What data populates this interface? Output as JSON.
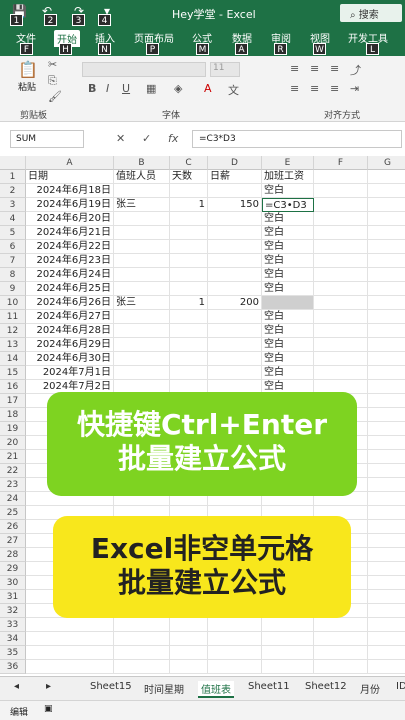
{
  "titlebar": {
    "title": "Hey学堂  -  Excel",
    "search_label": "搜索",
    "keytips": [
      "1",
      "2",
      "3",
      "4"
    ]
  },
  "ribbon_tabs": [
    {
      "label": "文件",
      "key": "F"
    },
    {
      "label": "开始",
      "key": "H",
      "active": true
    },
    {
      "label": "插入",
      "key": "N"
    },
    {
      "label": "页面布局",
      "key": "P"
    },
    {
      "label": "公式",
      "key": "M"
    },
    {
      "label": "数据",
      "key": "A"
    },
    {
      "label": "审阅",
      "key": "R"
    },
    {
      "label": "视图",
      "key": "W"
    },
    {
      "label": "开发工具",
      "key": "L"
    }
  ],
  "ribbon": {
    "paste_label": "粘贴",
    "clipboard_label": "剪贴板",
    "font_label": "字体",
    "align_label": "对齐方式",
    "font_size": "11"
  },
  "formula_bar": {
    "name_box": "SUM",
    "formula": "=C3*D3"
  },
  "columns": [
    "A",
    "B",
    "C",
    "D",
    "E",
    "F",
    "G"
  ],
  "rows": [
    {
      "n": "1",
      "a": "日期",
      "b": "值班人员",
      "c": "天数",
      "d": "日薪",
      "e": "加班工资"
    },
    {
      "n": "2",
      "a": "2024年6月18日",
      "b": "",
      "c": "",
      "d": "",
      "e": "空白"
    },
    {
      "n": "3",
      "a": "2024年6月19日",
      "b": "张三",
      "c": "1",
      "d": "150",
      "e": "=C3•D3"
    },
    {
      "n": "4",
      "a": "2024年6月20日",
      "b": "",
      "c": "",
      "d": "",
      "e": "空白"
    },
    {
      "n": "5",
      "a": "2024年6月21日",
      "b": "",
      "c": "",
      "d": "",
      "e": "空白"
    },
    {
      "n": "6",
      "a": "2024年6月22日",
      "b": "",
      "c": "",
      "d": "",
      "e": "空白"
    },
    {
      "n": "7",
      "a": "2024年6月23日",
      "b": "",
      "c": "",
      "d": "",
      "e": "空白"
    },
    {
      "n": "8",
      "a": "2024年6月24日",
      "b": "",
      "c": "",
      "d": "",
      "e": "空白"
    },
    {
      "n": "9",
      "a": "2024年6月25日",
      "b": "",
      "c": "",
      "d": "",
      "e": "空白"
    },
    {
      "n": "10",
      "a": "2024年6月26日",
      "b": "张三",
      "c": "1",
      "d": "200",
      "e": ""
    },
    {
      "n": "11",
      "a": "2024年6月27日",
      "b": "",
      "c": "",
      "d": "",
      "e": "空白"
    },
    {
      "n": "12",
      "a": "2024年6月28日",
      "b": "",
      "c": "",
      "d": "",
      "e": "空白"
    },
    {
      "n": "13",
      "a": "2024年6月29日",
      "b": "",
      "c": "",
      "d": "",
      "e": "空白"
    },
    {
      "n": "14",
      "a": "2024年6月30日",
      "b": "",
      "c": "",
      "d": "",
      "e": "空白"
    },
    {
      "n": "15",
      "a": "2024年7月1日",
      "b": "",
      "c": "",
      "d": "",
      "e": "空白"
    },
    {
      "n": "16",
      "a": "2024年7月2日",
      "b": "",
      "c": "",
      "d": "",
      "e": "空白"
    },
    {
      "n": "17",
      "a": "20",
      "b": "",
      "c": "",
      "d": "",
      "e": "空白"
    },
    {
      "n": "18"
    },
    {
      "n": "19"
    },
    {
      "n": "20"
    },
    {
      "n": "21"
    },
    {
      "n": "22"
    },
    {
      "n": "23"
    },
    {
      "n": "24"
    },
    {
      "n": "25"
    },
    {
      "n": "26"
    },
    {
      "n": "27"
    },
    {
      "n": "28"
    },
    {
      "n": "29"
    },
    {
      "n": "30"
    },
    {
      "n": "31"
    },
    {
      "n": "32"
    },
    {
      "n": "33"
    },
    {
      "n": "34"
    },
    {
      "n": "35"
    },
    {
      "n": "36"
    }
  ],
  "banners": {
    "green_line1": "快捷键Ctrl+Enter",
    "green_line2": "批量建立公式",
    "yellow_line1": "Excel非空单元格",
    "yellow_line2": "批量建立公式"
  },
  "sheet_tabs": [
    "Sheet15",
    "时间星期",
    "值班表",
    "Sheet11",
    "Sheet12",
    "月份",
    "ID"
  ],
  "active_sheet": "值班表",
  "status": "编辑",
  "colors": {
    "excel_green": "#1e7145",
    "banner_green": "#7ed321",
    "banner_yellow": "#f8e71c"
  }
}
